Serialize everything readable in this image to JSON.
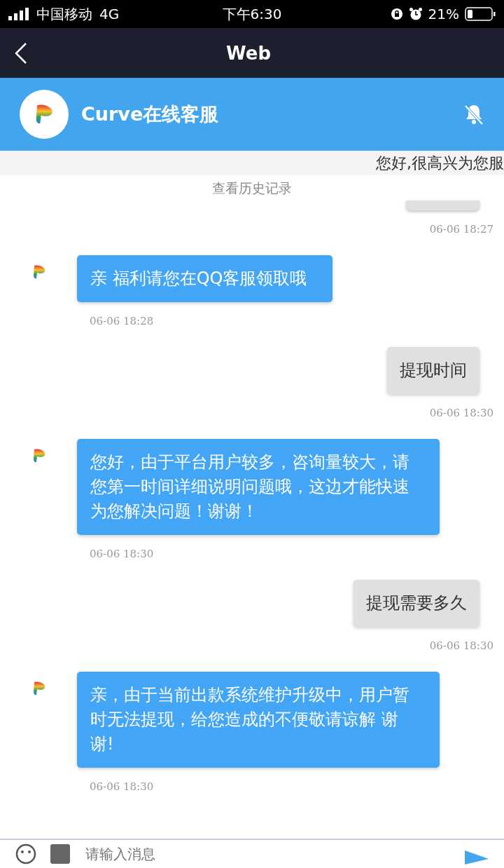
{
  "status_bar": {
    "carrier": "中国移动",
    "network": "4G",
    "time": "下午6:30",
    "battery": "21%"
  },
  "nav": {
    "title": "Web"
  },
  "chat_header": {
    "title": "Curve在线客服"
  },
  "notice": "您好,很高兴为您服",
  "history_link": "查看历史记录",
  "messages": [
    {
      "kind": "user_time",
      "text": "06-06 18:27"
    },
    {
      "kind": "agent",
      "text": "亲 福利请您在QQ客服领取哦"
    },
    {
      "kind": "agent_time",
      "text": "06-06 18:28"
    },
    {
      "kind": "user",
      "text": "提现时间"
    },
    {
      "kind": "user_time",
      "text": "06-06 18:30"
    },
    {
      "kind": "agent",
      "text": "您好，由于平台用户较多，咨询量较大，请您第一时间详细说明问题哦，这边才能快速为您解决问题！谢谢！"
    },
    {
      "kind": "agent_time",
      "text": "06-06 18:30"
    },
    {
      "kind": "user",
      "text": "提现需要多久"
    },
    {
      "kind": "user_time",
      "text": "06-06 18:30"
    },
    {
      "kind": "agent",
      "text": "亲，由于当前出款系统维护升级中，用户暂时无法提现，给您造成的不便敬请谅解 谢谢!"
    },
    {
      "kind": "agent_time",
      "text": "06-06 18:30"
    }
  ],
  "composer": {
    "placeholder": "请输入消息"
  }
}
